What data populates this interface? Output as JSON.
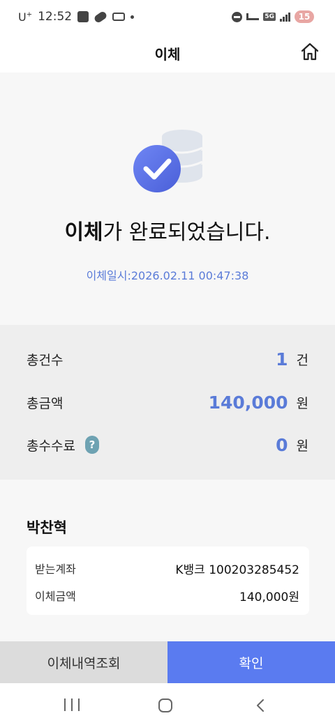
{
  "status_bar": {
    "carrier": "U",
    "carrier_sup": "+",
    "time": "12:52",
    "network_badge": "5G",
    "battery": "15"
  },
  "header": {
    "title": "이체",
    "home_icon": "home-icon"
  },
  "result": {
    "message_bold": "이체",
    "message_rest": "가 완료되었습니다.",
    "timestamp": "이체일시:2026.02.11 00:47:38",
    "icon": "check-circle-icon",
    "accent_color": "#5a7bd8"
  },
  "summary": {
    "count_label": "총건수",
    "count_value": "1",
    "count_unit": "건",
    "amount_label": "총금액",
    "amount_value": "140,000",
    "amount_unit": "원",
    "fee_label": "총수수료",
    "fee_help": "?",
    "fee_value": "0",
    "fee_unit": "원"
  },
  "recipient": {
    "name": "박찬혁",
    "rows": [
      {
        "label": "받는계좌",
        "value": "K뱅크 100203285452"
      },
      {
        "label": "이체금액",
        "value": "140,000원"
      }
    ]
  },
  "buttons": {
    "history": "이체내역조회",
    "confirm": "확인",
    "confirm_color": "#5a7bf0"
  }
}
